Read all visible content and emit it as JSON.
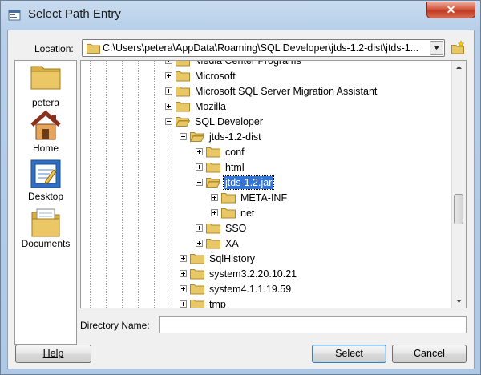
{
  "window": {
    "title": "Select Path Entry",
    "close_label": "✕"
  },
  "location": {
    "label": "Location:",
    "value": "C:\\Users\\petera\\AppData\\Roaming\\SQL Developer\\jtds-1.2-dist\\jtds-1..."
  },
  "places": [
    {
      "label": "petera",
      "icon": "folder-icon"
    },
    {
      "label": "Home",
      "icon": "house-icon"
    },
    {
      "label": "Desktop",
      "icon": "desktop-icon"
    },
    {
      "label": "Documents",
      "icon": "documents-icon"
    }
  ],
  "tree": [
    {
      "label": "Media Center Programs",
      "level": 0,
      "expanded": false
    },
    {
      "label": "Microsoft",
      "level": 0,
      "expanded": false
    },
    {
      "label": "Microsoft SQL Server Migration Assistant",
      "level": 0,
      "expanded": false
    },
    {
      "label": "Mozilla",
      "level": 0,
      "expanded": false
    },
    {
      "label": "SQL Developer",
      "level": 0,
      "expanded": true
    },
    {
      "label": "jtds-1.2-dist",
      "level": 1,
      "expanded": true
    },
    {
      "label": "conf",
      "level": 2,
      "expanded": false
    },
    {
      "label": "html",
      "level": 2,
      "expanded": false
    },
    {
      "label": "jtds-1.2.jar",
      "level": 2,
      "expanded": true,
      "selected": true
    },
    {
      "label": "META-INF",
      "level": 3,
      "expanded": false
    },
    {
      "label": "net",
      "level": 3,
      "expanded": false
    },
    {
      "label": "SSO",
      "level": 2,
      "expanded": false
    },
    {
      "label": "XA",
      "level": 2,
      "expanded": false
    },
    {
      "label": "SqlHistory",
      "level": 1,
      "expanded": false
    },
    {
      "label": "system3.2.20.10.21",
      "level": 1,
      "expanded": false
    },
    {
      "label": "system4.1.1.19.59",
      "level": 1,
      "expanded": false
    },
    {
      "label": "tmp",
      "level": 1,
      "expanded": false
    }
  ],
  "directory": {
    "label": "Directory Name:",
    "value": ""
  },
  "buttons": {
    "help": "Help",
    "select": "Select",
    "cancel": "Cancel"
  },
  "colors": {
    "selection": "#3375d6",
    "folder": "#e8c766"
  }
}
